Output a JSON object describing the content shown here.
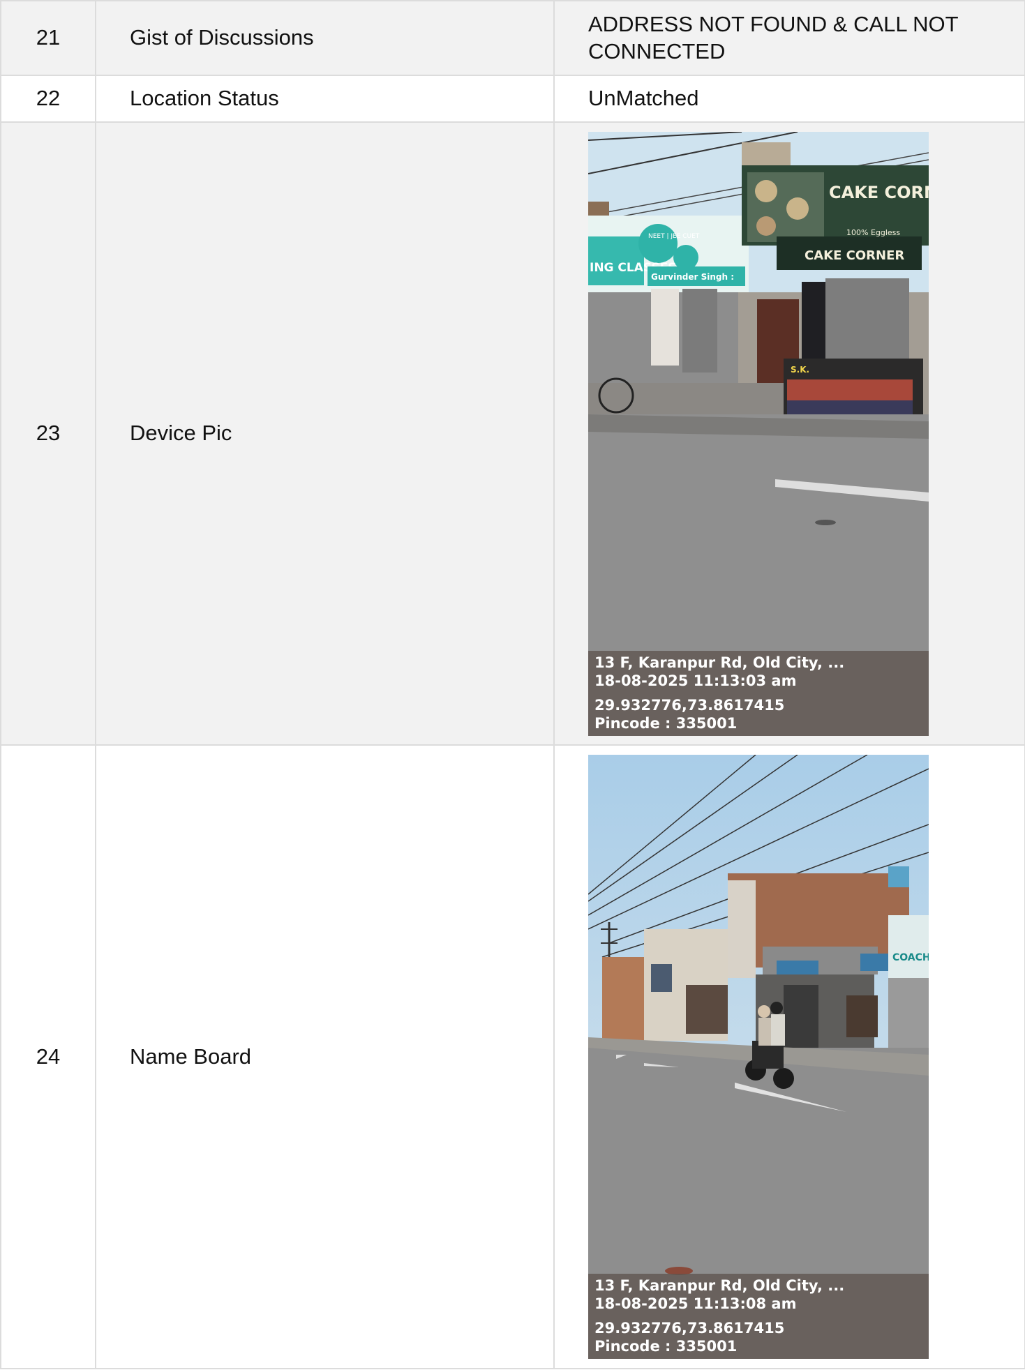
{
  "rows": [
    {
      "num": "21",
      "label": "Gist of Discussions",
      "value": "ADDRESS NOT FOUND & CALL NOT CONNECTED"
    },
    {
      "num": "22",
      "label": "Location Status",
      "value": "UnMatched"
    },
    {
      "num": "23",
      "label": "Device Pic",
      "photo": {
        "address": "13 F, Karanpur Rd, Old City, ...",
        "timestamp": "18-08-2025 11:13:03 am",
        "coords": "29.932776,73.8617415",
        "pincode": "Pincode : 335001",
        "sign_cake": "CAKE CORNER",
        "sign_cake2": "CAKE CORNER",
        "sign_eggless": "100% Eggless",
        "sign_classes": "ING CLASSES",
        "sign_neet": "NEET | JEE CUET",
        "sign_name": "Gurvinder Singh :",
        "sign_sk": "S.K."
      }
    },
    {
      "num": "24",
      "label": "Name Board",
      "photo": {
        "address": "13 F, Karanpur Rd, Old City, ...",
        "timestamp": "18-08-2025 11:13:08 am",
        "coords": "29.932776,73.8617415",
        "pincode": "Pincode : 335001",
        "sign_coaching": "COACHIN"
      }
    }
  ],
  "colors": {
    "border": "#dcdcdc",
    "shaded_row": "#f2f2f2",
    "sky": "#cfe3ef",
    "road": "#8f8f8f",
    "overlay": "#5f5550"
  }
}
